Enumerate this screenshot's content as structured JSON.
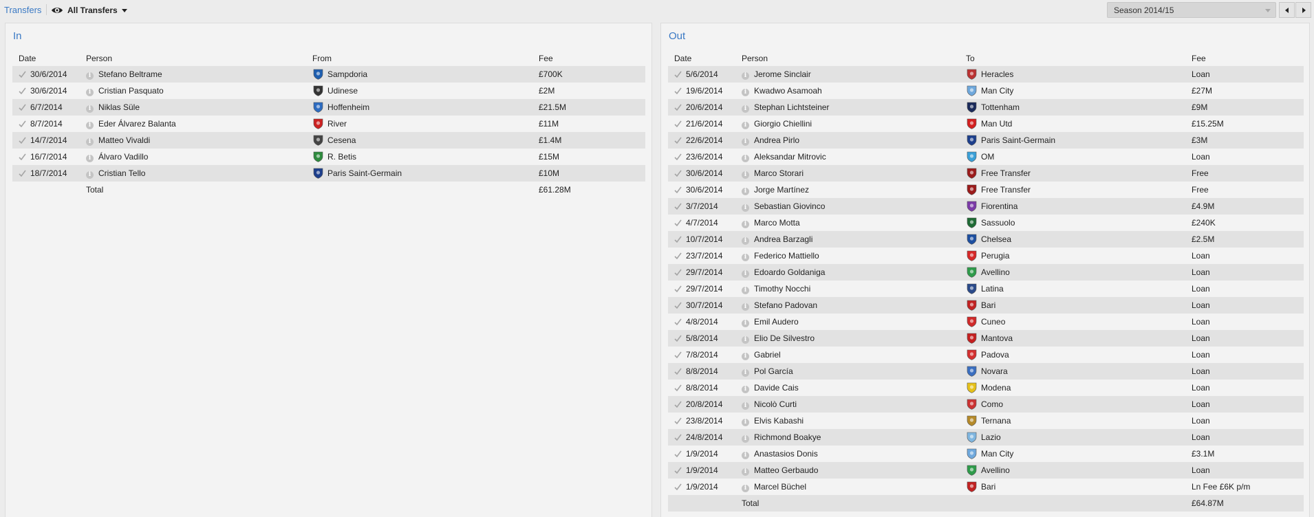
{
  "breadcrumb": "Transfers",
  "view": {
    "label": "All Transfers",
    "icon": "eye-icon"
  },
  "season": {
    "selected": "Season 2014/15"
  },
  "in_panel": {
    "title": "In",
    "headers": {
      "date": "Date",
      "person": "Person",
      "club": "From",
      "fee": "Fee"
    },
    "rows": [
      {
        "date": "30/6/2014",
        "person": "Stefano Beltrame",
        "club": "Sampdoria",
        "fee": "£700K",
        "crest": "#1f5fb0"
      },
      {
        "date": "30/6/2014",
        "person": "Cristian Pasquato",
        "club": "Udinese",
        "fee": "£2M",
        "crest": "#333333"
      },
      {
        "date": "6/7/2014",
        "person": "Niklas Süle",
        "club": "Hoffenheim",
        "fee": "£21.5M",
        "crest": "#2d6cc0"
      },
      {
        "date": "8/7/2014",
        "person": "Eder Álvarez Balanta",
        "club": "River",
        "fee": "£11M",
        "crest": "#cc2222"
      },
      {
        "date": "14/7/2014",
        "person": "Matteo Vivaldi",
        "club": "Cesena",
        "fee": "£1.4M",
        "crest": "#444444"
      },
      {
        "date": "16/7/2014",
        "person": "Álvaro Vadillo",
        "club": "R. Betis",
        "fee": "£15M",
        "crest": "#2e8b3e"
      },
      {
        "date": "18/7/2014",
        "person": "Cristian Tello",
        "club": "Paris Saint-Germain",
        "fee": "£10M",
        "crest": "#1d3f8c"
      }
    ],
    "total_label": "Total",
    "total_fee": "£61.28M"
  },
  "out_panel": {
    "title": "Out",
    "headers": {
      "date": "Date",
      "person": "Person",
      "club": "To",
      "fee": "Fee"
    },
    "rows": [
      {
        "date": "5/6/2014",
        "person": "Jerome Sinclair",
        "club": "Heracles",
        "fee": "Loan",
        "crest": "#bb3333"
      },
      {
        "date": "19/6/2014",
        "person": "Kwadwo Asamoah",
        "club": "Man City",
        "fee": "£27M",
        "crest": "#6fa8dc"
      },
      {
        "date": "20/6/2014",
        "person": "Stephan Lichtsteiner",
        "club": "Tottenham",
        "fee": "£9M",
        "crest": "#1a2a5a"
      },
      {
        "date": "21/6/2014",
        "person": "Giorgio Chiellini",
        "club": "Man Utd",
        "fee": "£15.25M",
        "crest": "#d32020"
      },
      {
        "date": "22/6/2014",
        "person": "Andrea Pirlo",
        "club": "Paris Saint-Germain",
        "fee": "£3M",
        "crest": "#1d3f8c"
      },
      {
        "date": "23/6/2014",
        "person": "Aleksandar Mitrovic",
        "club": "OM",
        "fee": "Loan",
        "crest": "#3aa0d8"
      },
      {
        "date": "30/6/2014",
        "person": "Marco Storari",
        "club": "Free Transfer",
        "fee": "Free",
        "crest": "#9b1b1b"
      },
      {
        "date": "30/6/2014",
        "person": "Jorge Martínez",
        "club": "Free Transfer",
        "fee": "Free",
        "crest": "#9b1b1b"
      },
      {
        "date": "3/7/2014",
        "person": "Sebastian Giovinco",
        "club": "Fiorentina",
        "fee": "£4.9M",
        "crest": "#7b3aa8"
      },
      {
        "date": "4/7/2014",
        "person": "Marco Motta",
        "club": "Sassuolo",
        "fee": "£240K",
        "crest": "#1f6b35"
      },
      {
        "date": "10/7/2014",
        "person": "Andrea Barzagli",
        "club": "Chelsea",
        "fee": "£2.5M",
        "crest": "#1d4fa0"
      },
      {
        "date": "23/7/2014",
        "person": "Federico Mattiello",
        "club": "Perugia",
        "fee": "Loan",
        "crest": "#d62828"
      },
      {
        "date": "29/7/2014",
        "person": "Edoardo Goldaniga",
        "club": "Avellino",
        "fee": "Loan",
        "crest": "#2e9b4a"
      },
      {
        "date": "29/7/2014",
        "person": "Timothy Nocchi",
        "club": "Latina",
        "fee": "Loan",
        "crest": "#2a4a8a"
      },
      {
        "date": "30/7/2014",
        "person": "Stefano Padovan",
        "club": "Bari",
        "fee": "Loan",
        "crest": "#c22222"
      },
      {
        "date": "4/8/2014",
        "person": "Emil Audero",
        "club": "Cuneo",
        "fee": "Loan",
        "crest": "#d02a2a"
      },
      {
        "date": "5/8/2014",
        "person": "Elio De Silvestro",
        "club": "Mantova",
        "fee": "Loan",
        "crest": "#c41f1f"
      },
      {
        "date": "7/8/2014",
        "person": "Gabriel",
        "club": "Padova",
        "fee": "Loan",
        "crest": "#d43030"
      },
      {
        "date": "8/8/2014",
        "person": "Pol García",
        "club": "Novara",
        "fee": "Loan",
        "crest": "#3b6fc0"
      },
      {
        "date": "8/8/2014",
        "person": "Davide Cais",
        "club": "Modena",
        "fee": "Loan",
        "crest": "#e6c11a"
      },
      {
        "date": "20/8/2014",
        "person": "Nicolò Curti",
        "club": "Como",
        "fee": "Loan",
        "crest": "#cc3333"
      },
      {
        "date": "23/8/2014",
        "person": "Elvis Kabashi",
        "club": "Ternana",
        "fee": "Loan",
        "crest": "#b58a2a"
      },
      {
        "date": "24/8/2014",
        "person": "Richmond Boakye",
        "club": "Lazio",
        "fee": "Loan",
        "crest": "#7fb6e0"
      },
      {
        "date": "1/9/2014",
        "person": "Anastasios Donis",
        "club": "Man City",
        "fee": "£3.1M",
        "crest": "#6fa8dc"
      },
      {
        "date": "1/9/2014",
        "person": "Matteo Gerbaudo",
        "club": "Avellino",
        "fee": "Loan",
        "crest": "#2e9b4a"
      },
      {
        "date": "1/9/2014",
        "person": "Marcel Büchel",
        "club": "Bari",
        "fee": "Ln Fee £6K p/m",
        "crest": "#c22222"
      }
    ],
    "total_label": "Total",
    "total_fee": "£64.87M"
  }
}
